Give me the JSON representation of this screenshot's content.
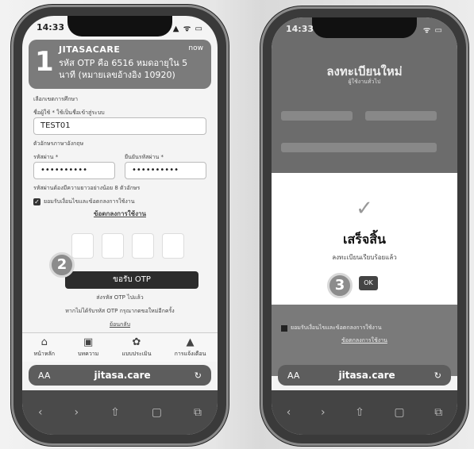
{
  "left_phone": {
    "status": {
      "time": "14:33",
      "icons": "▲ ᯤ ▭"
    },
    "otp_banner": {
      "step": "1",
      "title": "JITASACARE",
      "time": "now",
      "message": "รหัส OTP คือ 6516 หมดอายุใน 5 นาที (หมายเลขอ้างอิง 10920)"
    },
    "form": {
      "select_label": "เลือกเขตการศึกษา",
      "username_label": "ชื่อผู้ใช้ * ใช้เป็นชื่อเข้าสู่ระบบ",
      "username_value": "TEST01",
      "hint": "ตัวอักษรภาษาอังกฤษ",
      "password_label": "รหัสผ่าน *",
      "password_value": "••••••••••",
      "confirm_label": "ยืนยันรหัสผ่าน *",
      "confirm_value": "••••••••••",
      "note": "รหัสผ่านต้องมีความยาวอย่างน้อย 8 ตัวอักษร",
      "consent": "ยอมรับเงื่อนไขและข้อตกลงการใช้งาน",
      "terms_link": "ข้อตกลงการใช้งาน"
    },
    "step2": "2",
    "request_otp": "ขอรับ OTP",
    "otp_sent": "ส่งรหัส OTP ไปแล้ว",
    "otp_help": "หากไม่ได้รับรหัส OTP กรุณากดขอใหม่อีกครั้ง",
    "back": "ย้อนกลับ",
    "tabs": [
      {
        "icon": "home-icon",
        "glyph": "⌂",
        "label": "หน้าหลัก"
      },
      {
        "icon": "book-icon",
        "glyph": "▣",
        "label": "บทความ"
      },
      {
        "icon": "leaf-icon",
        "glyph": "✿",
        "label": "แบบประเมิน"
      },
      {
        "icon": "bell-icon",
        "glyph": "▲",
        "label": "การแจ้งเตือน"
      }
    ],
    "url": "jitasa.care",
    "aa": "AA",
    "reload": "↻",
    "nav": [
      "‹",
      "›",
      "⇧",
      "▢",
      "⧉"
    ]
  },
  "right_phone": {
    "status": {
      "time": "14:33",
      "icons": "ᯤ ▭"
    },
    "title": "ลงทะเบียนใหม่",
    "subtitle": "ผู้ใช้งานทั่วไป",
    "done_title": "เสร็จสิ้น",
    "done_msg": "ลงทะเบียนเรียบร้อยแล้ว",
    "step3": "3",
    "ok": "OK",
    "consent": "ยอมรับเงื่อนไขและข้อตกลงการใช้งาน",
    "terms_link": "ข้อตกลงการใช้งาน",
    "url": "jitasa.care",
    "aa": "AA",
    "reload": "↻"
  }
}
